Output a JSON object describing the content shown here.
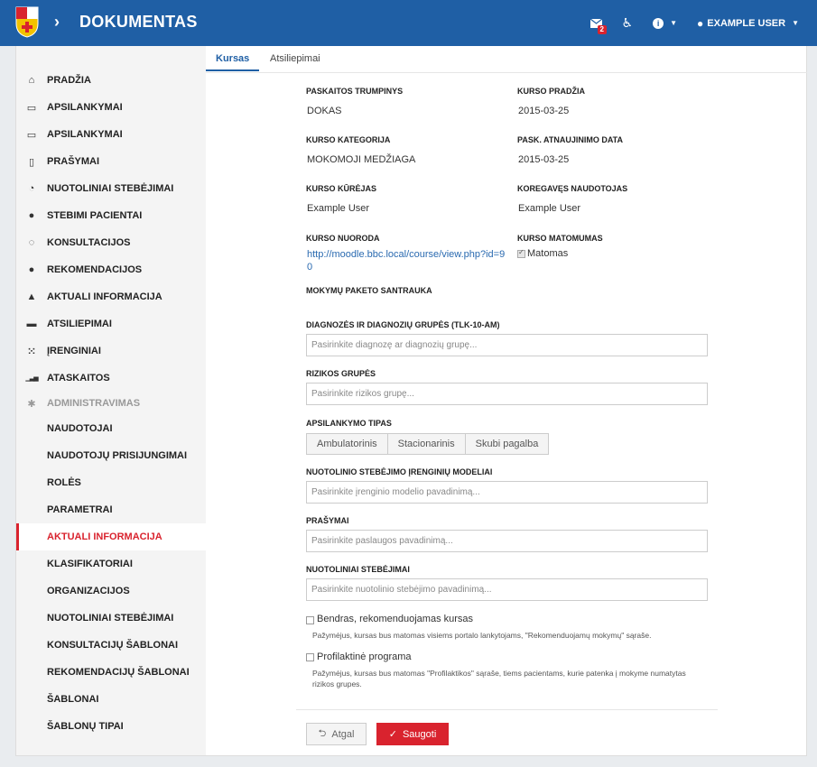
{
  "header": {
    "brand": "DOKUMENTAS",
    "message_badge": "2",
    "user_name": "EXAMPLE USER"
  },
  "sidebar": {
    "items": [
      {
        "label": "PRADŽIA",
        "icon": "home-icon",
        "glyph": "⌂"
      },
      {
        "label": "APSILANKYMAI",
        "icon": "calendar-icon",
        "glyph": "▭"
      },
      {
        "label": "APSILANKYMAI",
        "icon": "calendar-icon",
        "glyph": "▭"
      },
      {
        "label": "PRAŠYMAI",
        "icon": "document-icon",
        "glyph": "▯"
      },
      {
        "label": "NUOTOLINIAI STEBĖJIMAI",
        "icon": "wifi-icon",
        "glyph": "◔"
      },
      {
        "label": "STEBIMI PACIENTAI",
        "icon": "user-icon",
        "glyph": "●"
      },
      {
        "label": "KONSULTACIJOS",
        "icon": "chat-search-icon",
        "glyph": "◌"
      },
      {
        "label": "REKOMENDACIJOS",
        "icon": "speech-bubble-icon",
        "glyph": "●"
      },
      {
        "label": "AKTUALI INFORMACIJA",
        "icon": "graduation-cap-icon",
        "glyph": "▲"
      },
      {
        "label": "ATSILIEPIMAI",
        "icon": "comment-icon",
        "glyph": "▬"
      },
      {
        "label": "ĮRENGINIAI",
        "icon": "grid-icon",
        "glyph": "⁙"
      },
      {
        "label": "ATASKAITOS",
        "icon": "bar-chart-icon",
        "glyph": "▁▃▅"
      }
    ],
    "admin_label": "ADMINISTRAVIMAS",
    "sub_items": [
      "NAUDOTOJAI",
      "NAUDOTOJŲ PRISIJUNGIMAI",
      "ROLĖS",
      "PARAMETRAI",
      "AKTUALI INFORMACIJA",
      "KLASIFIKATORIAI",
      "ORGANIZACIJOS",
      "NUOTOLINIAI STEBĖJIMAI",
      "KONSULTACIJŲ ŠABLONAI",
      "REKOMENDACIJŲ ŠABLONAI",
      "ŠABLONAI",
      "ŠABLONŲ TIPAI"
    ],
    "active_sub_index": 4
  },
  "tabs": {
    "active": "Kursas",
    "inactive": "Atsiliepimai"
  },
  "details": {
    "short_name_label": "PASKAITOS TRUMPINYS",
    "short_name_value": "DOKAS",
    "start_label": "KURSO PRADŽIA",
    "start_value": "2015-03-25",
    "category_label": "KURSO KATEGORIJA",
    "category_value": "MOKOMOJI MEDŽIAGA",
    "updated_label": "PASK. ATNAUJINIMO DATA",
    "updated_value": "2015-03-25",
    "creator_label": "KURSO KŪRĖJAS",
    "creator_value": "Example User",
    "editor_label": "KOREGAVĘS NAUDOTOJAS",
    "editor_value": "Example User",
    "link_label": "KURSO NUORODA",
    "link_value": "http://moodle.bbc.local/course/view.php?id=90",
    "visibility_label": "KURSO MATOMUMAS",
    "visibility_value": "Matomas",
    "summary_label": "MOKYMŲ PAKETO SANTRAUKA"
  },
  "form": {
    "diagnosis_label": "DIAGNOZĖS IR DIAGNOZIŲ GRUPĖS (TLK-10-AM)",
    "diagnosis_placeholder": "Pasirinkite diagnozę ar diagnozių grupę...",
    "risk_label": "RIZIKOS GRUPĖS",
    "risk_placeholder": "Pasirinkite rizikos grupę...",
    "visit_type_label": "APSILANKYMO TIPAS",
    "visit_types": [
      "Ambulatorinis",
      "Stacionarinis",
      "Skubi pagalba"
    ],
    "device_label": "NUOTOLINIO STEBĖJIMO ĮRENGINIŲ MODELIAI",
    "device_placeholder": "Pasirinkite įrenginio modelio pavadinimą...",
    "requests_label": "PRAŠYMAI",
    "requests_placeholder": "Pasirinkite paslaugos pavadinimą...",
    "monitoring_label": "NUOTOLINIAI STEBĖJIMAI",
    "monitoring_placeholder": "Pasirinkite nuotolinio stebėjimo pavadinimą...",
    "general_checkbox_label": "Bendras, rekomenduojamas kursas",
    "general_hint": "Pažymėjus, kursas bus matomas visiems portalo lankytojams, \"Rekomenduojamų mokymų\" sąraše.",
    "prevent_checkbox_label": "Profilaktinė programa",
    "prevent_hint": "Pažymėjus, kursas bus matomas \"Profilaktikos\" sąraše, tiems pacientams, kurie patenka į mokyme numatytas rizikos grupes."
  },
  "buttons": {
    "back": "Atgal",
    "save": "Saugoti"
  },
  "colors": {
    "header": "#1f5fa5",
    "accent": "#d9232e"
  }
}
